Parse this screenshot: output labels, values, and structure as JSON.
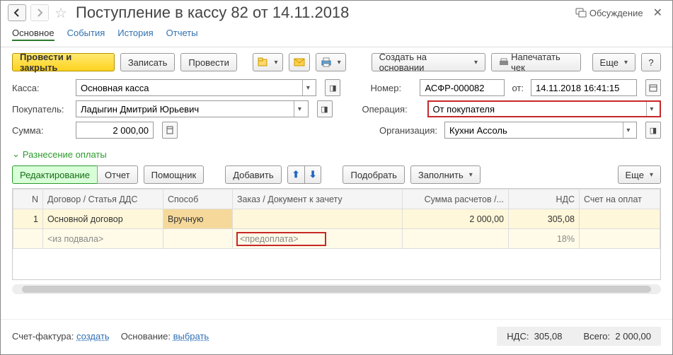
{
  "title": "Поступление в кассу 82 от 14.11.2018",
  "title_right": {
    "discuss": "Обсуждение"
  },
  "tabs": [
    "Основное",
    "События",
    "История",
    "Отчеты"
  ],
  "toolbar": {
    "post_close": "Провести и закрыть",
    "save": "Записать",
    "post": "Провести",
    "create_based": "Создать на основании",
    "print_check": "Напечатать чек",
    "more": "Еще",
    "help": "?"
  },
  "form": {
    "kassa_label": "Касса:",
    "kassa_value": "Основная касса",
    "number_label": "Номер:",
    "number_value": "АСФР-000082",
    "from_label": "от:",
    "date_value": "14.11.2018 16:41:15",
    "buyer_label": "Покупатель:",
    "buyer_value": "Ладыгин Дмитрий Юрьевич",
    "operation_label": "Операция:",
    "operation_value": "От покупателя",
    "sum_label": "Сумма:",
    "sum_value": "2 000,00",
    "org_label": "Организация:",
    "org_value": "Кухни Ассоль"
  },
  "payment_section": "Разнесение оплаты",
  "table_toolbar": {
    "edit": "Редактирование",
    "report": "Отчет",
    "assistant": "Помощник",
    "add": "Добавить",
    "pick": "Подобрать",
    "fill": "Заполнить",
    "more": "Еще"
  },
  "grid": {
    "headers": {
      "n": "N",
      "dds": "Договор / Статья ДДС",
      "sposob": "Способ",
      "zak": "Заказ / Документ к зачету",
      "sum": "Сумма расчетов /...",
      "nds": "НДС",
      "schet": "Счет на оплат"
    },
    "rows": [
      {
        "n": "1",
        "dds": "Основной договор",
        "sposob": "Вручную",
        "zak": "",
        "sum": "2 000,00",
        "nds": "305,08",
        "schet": ""
      },
      {
        "n": "",
        "dds": "<из подвала>",
        "sposob": "",
        "zak": "<предоплата>",
        "sum": "",
        "nds": "18%",
        "schet": ""
      }
    ]
  },
  "footer": {
    "sf_label": "Счет-фактура:",
    "sf_link": "создать",
    "osn_label": "Основание:",
    "osn_link": "выбрать",
    "nds_label": "НДС:",
    "nds_val": "305,08",
    "total_label": "Всего:",
    "total_val": "2 000,00"
  }
}
